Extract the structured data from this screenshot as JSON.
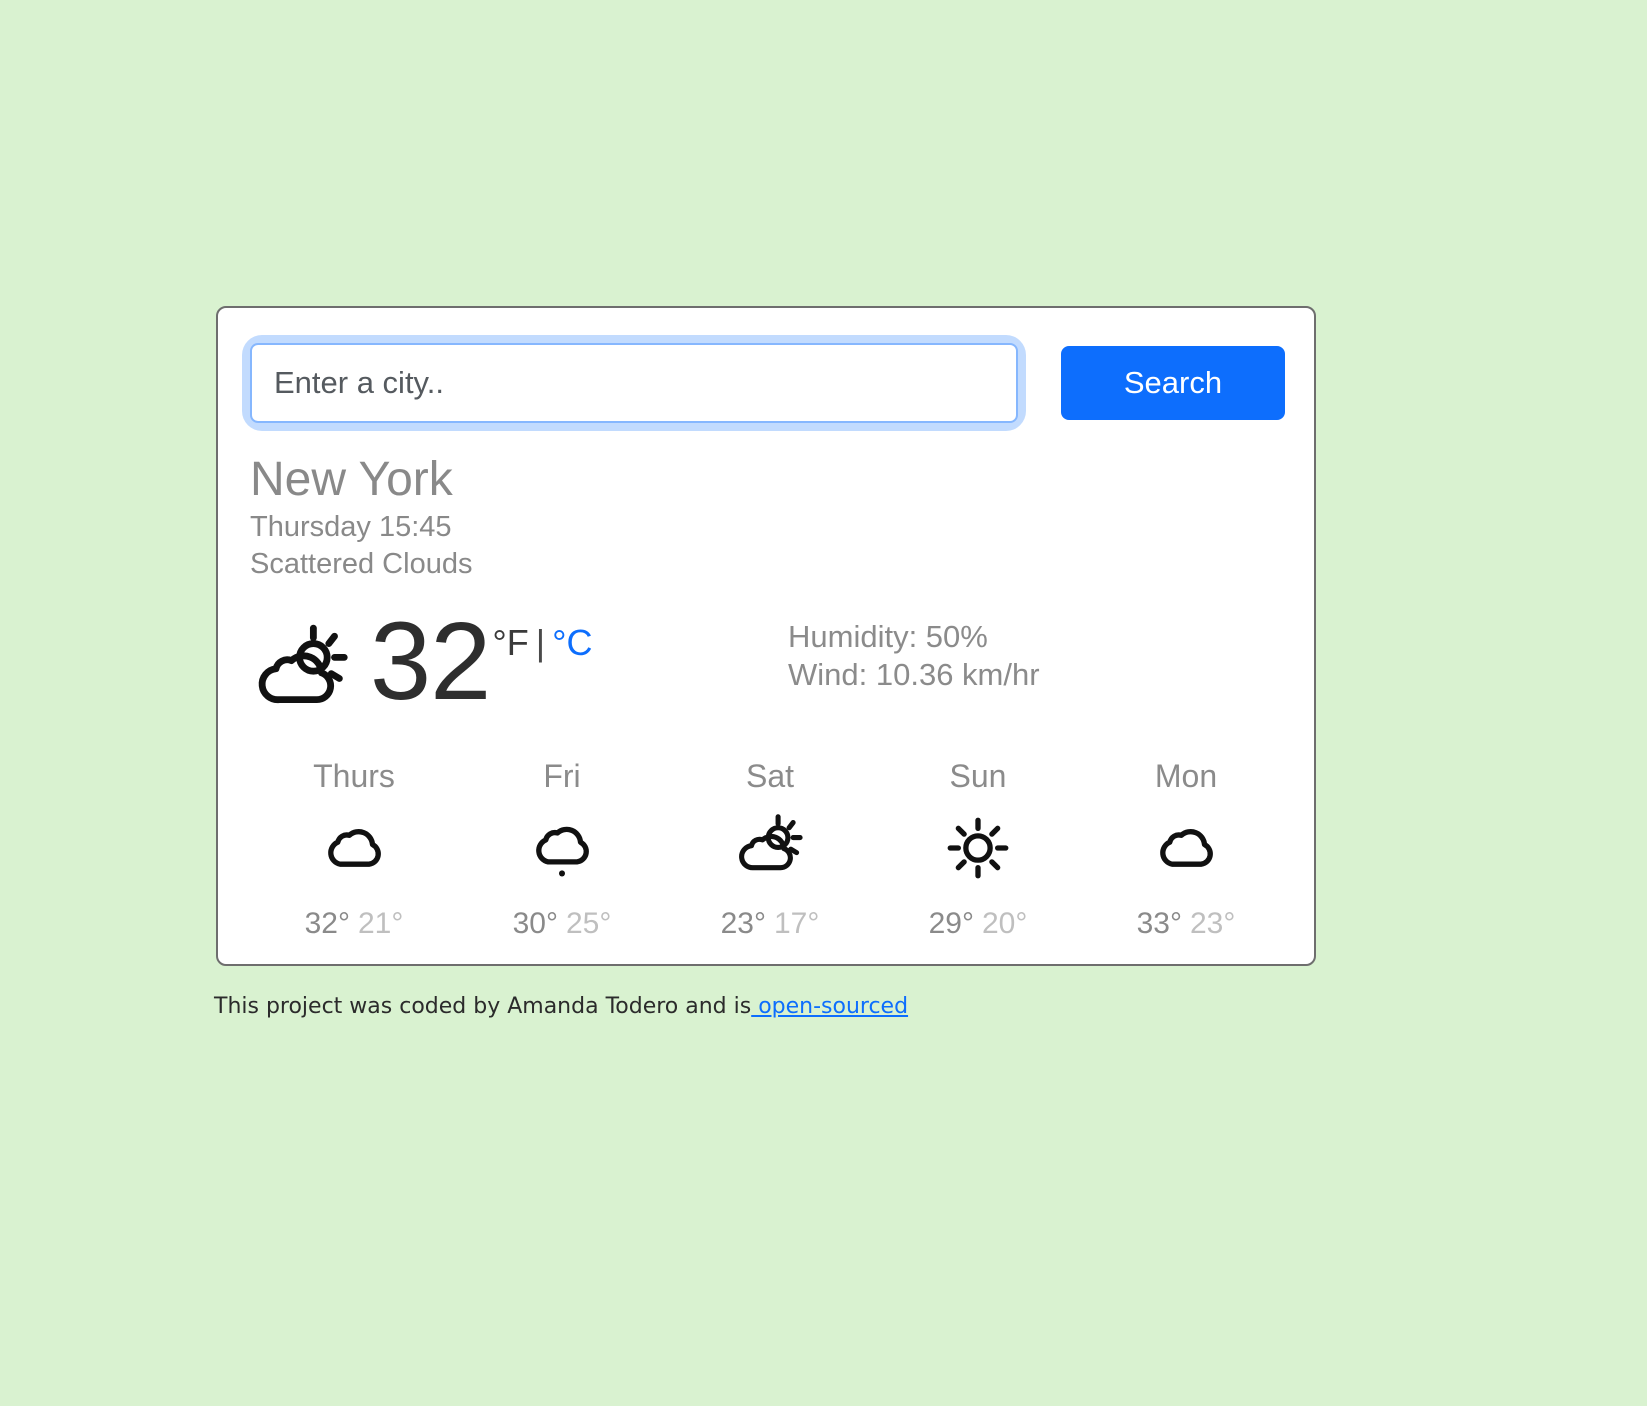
{
  "theme": {
    "page_background": "#d9f2d0",
    "card_background": "#ffffff",
    "accent": "#0d6efd",
    "muted_text": "#8b8b8b"
  },
  "search": {
    "placeholder": "Enter a city..",
    "value": "",
    "button_label": "Search"
  },
  "current": {
    "city": "New York",
    "datetime": "Thursday 15:45",
    "condition": "Scattered Clouds",
    "icon": "sun-behind-cloud-icon",
    "temperature": "32",
    "unit_fahrenheit": "°F",
    "unit_separator": "|",
    "unit_celsius": "°C",
    "active_unit": "°F",
    "humidity": "Humidity: 50%",
    "wind": "Wind: 10.36 km/hr"
  },
  "forecast": [
    {
      "day": "Thurs",
      "icon": "cloud-icon",
      "high": "32°",
      "low": "21°"
    },
    {
      "day": "Fri",
      "icon": "cloud-snow-icon",
      "high": "30°",
      "low": "25°"
    },
    {
      "day": "Sat",
      "icon": "sun-behind-cloud-icon",
      "high": "23°",
      "low": "17°"
    },
    {
      "day": "Sun",
      "icon": "sun-icon",
      "high": "29°",
      "low": "20°"
    },
    {
      "day": "Mon",
      "icon": "cloud-icon",
      "high": "33°",
      "low": "23°"
    }
  ],
  "footer": {
    "text": "This project was coded by Amanda Todero and is",
    "link_label": " open-sourced"
  }
}
